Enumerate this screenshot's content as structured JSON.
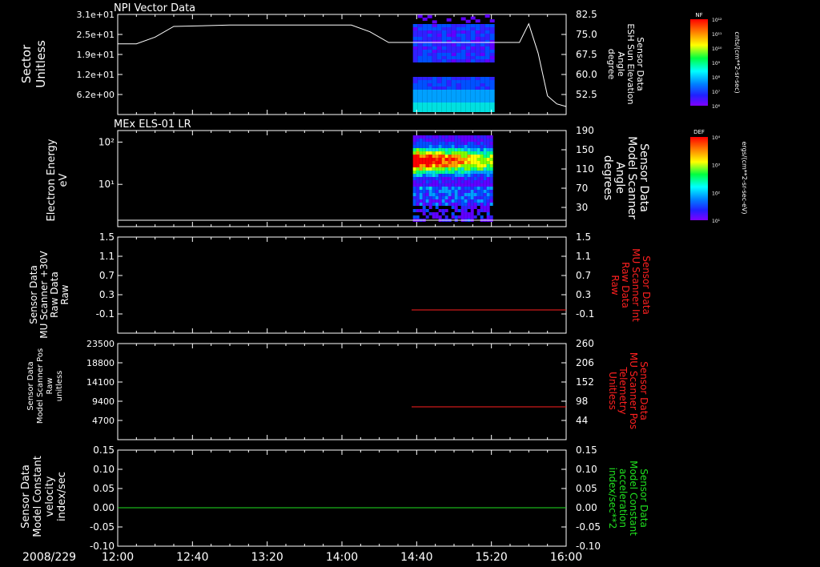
{
  "date_label": "2008/229",
  "time_ticks": [
    "12:00",
    "12:40",
    "13:20",
    "14:00",
    "14:40",
    "15:20",
    "16:00"
  ],
  "colorbars": [
    {
      "label": "NF",
      "units": "cnts/(cm**2-sr-sec)",
      "ticks": [
        "10¹²",
        "10¹¹",
        "10¹⁰",
        "10⁹",
        "10⁸",
        "10⁷",
        "10⁶"
      ]
    },
    {
      "label": "DEF",
      "units": "ergs/(cm**2-sr-sec-eV)",
      "ticks": [
        "10⁴",
        "10³",
        "10²",
        "10¹"
      ]
    }
  ],
  "chart_data": [
    {
      "type": "heatmap",
      "title": "NPI Vector Data",
      "ylabel_left": [
        "Sector",
        "Unitless"
      ],
      "yticks_left": [
        "3.1e+01",
        "2.5e+01",
        "1.9e+01",
        "1.2e+01",
        "6.2e+00"
      ],
      "ylabel_right": [
        "Sensor Data",
        "ESH Sun Elevation",
        "Angle",
        "degree"
      ],
      "yticks_right": [
        "82.5",
        "75.0",
        "67.5",
        "60.0",
        "52.5"
      ],
      "right_range": [
        45,
        82.5
      ],
      "spectrogram_time": [
        "14:38",
        "15:20"
      ],
      "line_series": {
        "name": "ESH Sun Elevation Angle",
        "x": [
          "12:00",
          "12:10",
          "12:20",
          "12:30",
          "13:00",
          "13:30",
          "14:05",
          "14:15",
          "14:25",
          "14:40",
          "15:20",
          "15:35",
          "15:40",
          "15:45",
          "15:50",
          "15:55",
          "16:00"
        ],
        "y": [
          71.5,
          71.5,
          74,
          78,
          78.5,
          78.5,
          78.5,
          76,
          72,
          72,
          72,
          72,
          79,
          68,
          52,
          49,
          48
        ]
      }
    },
    {
      "type": "heatmap",
      "title": "MEx ELS-01 LR",
      "ylabel_left": [
        "Electron Energy",
        "eV"
      ],
      "yticks_left": [
        "10²",
        "10¹"
      ],
      "ylabel_right": [
        "Sensor Data",
        "Model Scanner",
        "Angle",
        "degrees"
      ],
      "yticks_right": [
        "190",
        "150",
        "110",
        "70",
        "30"
      ],
      "right_range": [
        0,
        190
      ],
      "spectrogram_time": [
        "14:38",
        "15:20"
      ],
      "line_series": {
        "name": "Model Scanner Angle",
        "x": [
          "12:00",
          "16:00"
        ],
        "y": [
          10,
          10
        ]
      }
    },
    {
      "type": "line",
      "ylabel_left": [
        "Sensor Data",
        "MU Scanner +30V",
        "Raw Data",
        "Raw"
      ],
      "yticks_left": [
        "1.5",
        "1.1",
        "0.7",
        "0.3",
        "-0.1"
      ],
      "ylabel_right": [
        "Sensor Data",
        "MU Scanner Int",
        "Raw Data",
        "Raw"
      ],
      "yticks_right": [
        "1.5",
        "1.1",
        "0.7",
        "0.3",
        "-0.1"
      ],
      "ylim": [
        -0.5,
        1.5
      ],
      "series": [
        {
          "name": "MU Scanner Int Raw Data",
          "color": "#ff2020",
          "x": [
            "14:40",
            "16:00"
          ],
          "y": [
            0,
            0
          ]
        }
      ]
    },
    {
      "type": "line",
      "ylabel_left": [
        "Sensor Data",
        "Model Scanner Pos",
        "Raw",
        "unitless"
      ],
      "yticks_left": [
        "23500",
        "18800",
        "14100",
        "9400",
        "4700"
      ],
      "ylabel_right": [
        "Sensor Data",
        "MU Scanner Pos",
        "Telemetry",
        "Unitless"
      ],
      "yticks_right": [
        "260",
        "206",
        "152",
        "98",
        "44"
      ],
      "left_range": [
        0,
        23500
      ],
      "right_range": [
        0,
        260
      ],
      "series": [
        {
          "name": "MU Scanner Pos Telemetry",
          "color": "#ff2020",
          "x": [
            "14:40",
            "16:00"
          ],
          "y": [
            82,
            82
          ]
        }
      ]
    },
    {
      "type": "line",
      "ylabel_left": [
        "Sensor Data",
        "Model Constant",
        "velocity",
        "index/sec"
      ],
      "yticks_left": [
        "0.15",
        "0.10",
        "0.05",
        "0.00",
        "-0.05",
        "-0.10"
      ],
      "ylabel_right": [
        "Sensor Data",
        "Model Constant",
        "acceleration",
        "index/sec**2"
      ],
      "yticks_right": [
        "0.15",
        "0.10",
        "0.05",
        "0.00",
        "-0.05",
        "-0.10"
      ],
      "ylim": [
        -0.1,
        0.15
      ],
      "series": [
        {
          "name": "Model Constant",
          "color": "#20e020",
          "x": [
            "12:00",
            "16:00"
          ],
          "y": [
            0,
            0
          ]
        }
      ]
    }
  ]
}
